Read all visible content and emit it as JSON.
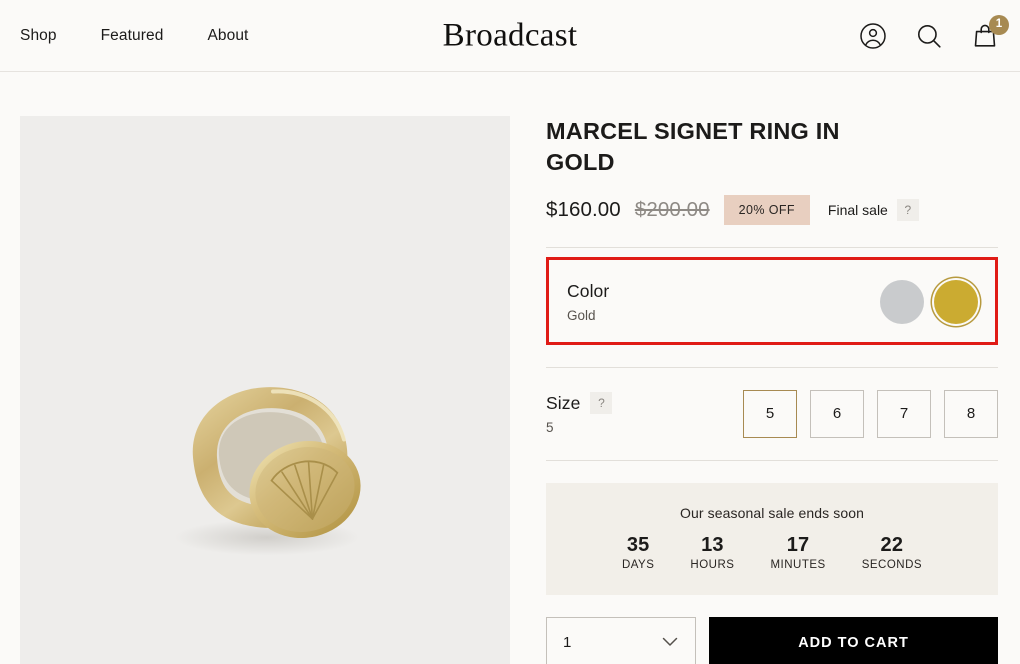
{
  "header": {
    "nav": [
      {
        "label": "Shop"
      },
      {
        "label": "Featured"
      },
      {
        "label": "About"
      }
    ],
    "logo": "Broadcast",
    "account_icon": "user-account-icon",
    "search_icon": "search-icon",
    "cart_icon": "shopping-bag-icon",
    "cart_count": "1",
    "cart_badge_color": "#a78a52"
  },
  "gallery": {
    "image_alt": "Gold signet ring with engraved fan motif",
    "background_color": "#eeedeb"
  },
  "product": {
    "title": "MARCEL SIGNET RING IN GOLD",
    "price_current": "$160.00",
    "price_compare": "$200.00",
    "discount_badge": "20% OFF",
    "discount_badge_color": "#e8cfc0",
    "final_sale_label": "Final sale",
    "final_sale_help": "?"
  },
  "color_option": {
    "label": "Color",
    "selected_value": "Gold",
    "highlight_color": "#e01b16",
    "swatches": [
      {
        "name": "Silver",
        "hex": "#c9cbcd",
        "selected": false
      },
      {
        "name": "Gold",
        "hex": "#cbab31",
        "selected": true
      }
    ]
  },
  "size_option": {
    "label": "Size",
    "help": "?",
    "selected_value": "5",
    "tiles": [
      {
        "label": "5",
        "selected": true
      },
      {
        "label": "6",
        "selected": false
      },
      {
        "label": "7",
        "selected": false
      },
      {
        "label": "8",
        "selected": false
      }
    ]
  },
  "countdown": {
    "title": "Our seasonal sale ends soon",
    "background_color": "#f2efe9",
    "units": [
      {
        "value": "35",
        "label": "DAYS"
      },
      {
        "value": "13",
        "label": "HOURS"
      },
      {
        "value": "17",
        "label": "MINUTES"
      },
      {
        "value": "22",
        "label": "SECONDS"
      }
    ]
  },
  "purchase": {
    "quantity": "1",
    "quantity_chevron": "chevron-down-icon",
    "add_to_cart_label": "ADD TO CART"
  }
}
